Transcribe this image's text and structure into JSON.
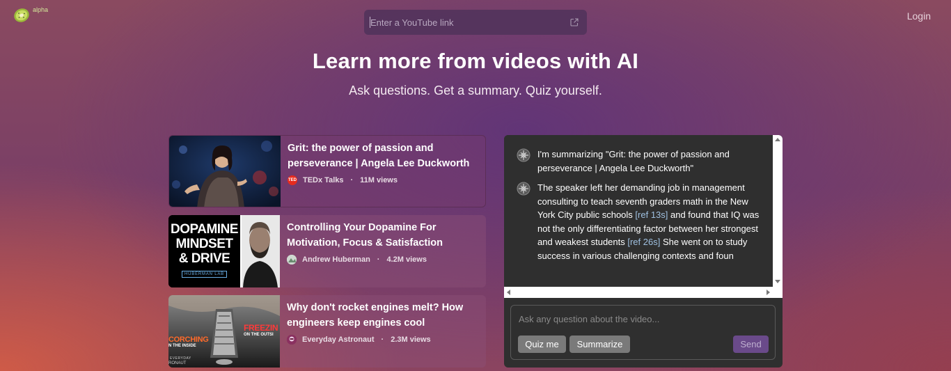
{
  "brand": {
    "badge": "alpha",
    "logo_icon": "kiwi-logo-icon"
  },
  "header": {
    "search_placeholder": "Enter a YouTube link",
    "login_label": "Login"
  },
  "hero": {
    "title": "Learn more from videos with AI",
    "subtitle": "Ask questions. Get a summary. Quiz yourself."
  },
  "videos": [
    {
      "title": "Grit: the power of passion and perseverance | Angela Lee Duckworth",
      "channel": "TEDx Talks",
      "views": "11M views",
      "channel_badge": "TED"
    },
    {
      "title": "Controlling Your Dopamine For Motivation, Focus & Satisfaction",
      "channel": "Andrew Huberman",
      "views": "4.2M views",
      "thumb_lines": [
        "DOPAMINE",
        "MINDSET",
        "& DRIVE"
      ],
      "thumb_tag": "HUBERMAN LAB"
    },
    {
      "title": "Why don't rocket engines melt? How engineers keep engines cool",
      "channel": "Everyday Astronaut",
      "views": "2.3M views",
      "thumb_left": "CORCHING",
      "thumb_left_sub": "N THE INSIDE",
      "thumb_right": "FREEZIN",
      "thumb_right_sub": "ON THE OUTSI",
      "thumb_brand": "EVERYDAY",
      "thumb_brand2": "RONAUT"
    }
  ],
  "chat": {
    "messages": [
      {
        "text": "I'm summarizing \"Grit: the power of passion and perseverance | Angela Lee Duckworth\""
      },
      {
        "part1": "The speaker left her demanding job in management consulting to teach seventh graders math in the New York City public schools ",
        "ref1": "[ref 13s]",
        "part2": " and found that IQ was not the only differentiating factor between her strongest and weakest students ",
        "ref2": "[ref 26s]",
        "part3": " She went on to study success in various challenging contexts and foun"
      }
    ],
    "input_placeholder": "Ask any question about the video...",
    "buttons": {
      "quiz": "Quiz me",
      "summarize": "Summarize",
      "send": "Send"
    }
  }
}
